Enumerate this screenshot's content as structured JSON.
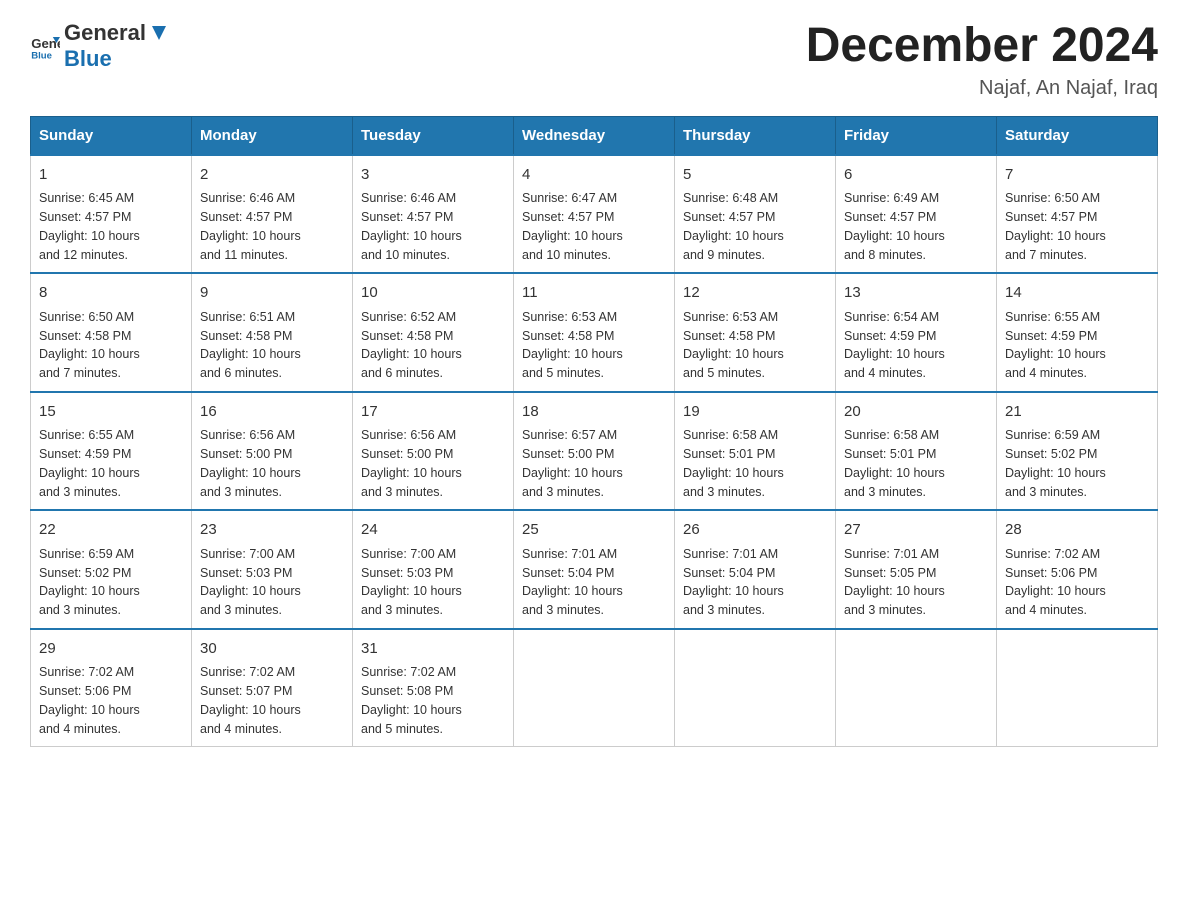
{
  "header": {
    "logo_general": "General",
    "logo_blue": "Blue",
    "month_title": "December 2024",
    "location": "Najaf, An Najaf, Iraq"
  },
  "days_of_week": [
    "Sunday",
    "Monday",
    "Tuesday",
    "Wednesday",
    "Thursday",
    "Friday",
    "Saturday"
  ],
  "weeks": [
    [
      {
        "day": "1",
        "sunrise": "6:45 AM",
        "sunset": "4:57 PM",
        "daylight": "10 hours and 12 minutes."
      },
      {
        "day": "2",
        "sunrise": "6:46 AM",
        "sunset": "4:57 PM",
        "daylight": "10 hours and 11 minutes."
      },
      {
        "day": "3",
        "sunrise": "6:46 AM",
        "sunset": "4:57 PM",
        "daylight": "10 hours and 10 minutes."
      },
      {
        "day": "4",
        "sunrise": "6:47 AM",
        "sunset": "4:57 PM",
        "daylight": "10 hours and 10 minutes."
      },
      {
        "day": "5",
        "sunrise": "6:48 AM",
        "sunset": "4:57 PM",
        "daylight": "10 hours and 9 minutes."
      },
      {
        "day": "6",
        "sunrise": "6:49 AM",
        "sunset": "4:57 PM",
        "daylight": "10 hours and 8 minutes."
      },
      {
        "day": "7",
        "sunrise": "6:50 AM",
        "sunset": "4:57 PM",
        "daylight": "10 hours and 7 minutes."
      }
    ],
    [
      {
        "day": "8",
        "sunrise": "6:50 AM",
        "sunset": "4:58 PM",
        "daylight": "10 hours and 7 minutes."
      },
      {
        "day": "9",
        "sunrise": "6:51 AM",
        "sunset": "4:58 PM",
        "daylight": "10 hours and 6 minutes."
      },
      {
        "day": "10",
        "sunrise": "6:52 AM",
        "sunset": "4:58 PM",
        "daylight": "10 hours and 6 minutes."
      },
      {
        "day": "11",
        "sunrise": "6:53 AM",
        "sunset": "4:58 PM",
        "daylight": "10 hours and 5 minutes."
      },
      {
        "day": "12",
        "sunrise": "6:53 AM",
        "sunset": "4:58 PM",
        "daylight": "10 hours and 5 minutes."
      },
      {
        "day": "13",
        "sunrise": "6:54 AM",
        "sunset": "4:59 PM",
        "daylight": "10 hours and 4 minutes."
      },
      {
        "day": "14",
        "sunrise": "6:55 AM",
        "sunset": "4:59 PM",
        "daylight": "10 hours and 4 minutes."
      }
    ],
    [
      {
        "day": "15",
        "sunrise": "6:55 AM",
        "sunset": "4:59 PM",
        "daylight": "10 hours and 3 minutes."
      },
      {
        "day": "16",
        "sunrise": "6:56 AM",
        "sunset": "5:00 PM",
        "daylight": "10 hours and 3 minutes."
      },
      {
        "day": "17",
        "sunrise": "6:56 AM",
        "sunset": "5:00 PM",
        "daylight": "10 hours and 3 minutes."
      },
      {
        "day": "18",
        "sunrise": "6:57 AM",
        "sunset": "5:00 PM",
        "daylight": "10 hours and 3 minutes."
      },
      {
        "day": "19",
        "sunrise": "6:58 AM",
        "sunset": "5:01 PM",
        "daylight": "10 hours and 3 minutes."
      },
      {
        "day": "20",
        "sunrise": "6:58 AM",
        "sunset": "5:01 PM",
        "daylight": "10 hours and 3 minutes."
      },
      {
        "day": "21",
        "sunrise": "6:59 AM",
        "sunset": "5:02 PM",
        "daylight": "10 hours and 3 minutes."
      }
    ],
    [
      {
        "day": "22",
        "sunrise": "6:59 AM",
        "sunset": "5:02 PM",
        "daylight": "10 hours and 3 minutes."
      },
      {
        "day": "23",
        "sunrise": "7:00 AM",
        "sunset": "5:03 PM",
        "daylight": "10 hours and 3 minutes."
      },
      {
        "day": "24",
        "sunrise": "7:00 AM",
        "sunset": "5:03 PM",
        "daylight": "10 hours and 3 minutes."
      },
      {
        "day": "25",
        "sunrise": "7:01 AM",
        "sunset": "5:04 PM",
        "daylight": "10 hours and 3 minutes."
      },
      {
        "day": "26",
        "sunrise": "7:01 AM",
        "sunset": "5:04 PM",
        "daylight": "10 hours and 3 minutes."
      },
      {
        "day": "27",
        "sunrise": "7:01 AM",
        "sunset": "5:05 PM",
        "daylight": "10 hours and 3 minutes."
      },
      {
        "day": "28",
        "sunrise": "7:02 AM",
        "sunset": "5:06 PM",
        "daylight": "10 hours and 4 minutes."
      }
    ],
    [
      {
        "day": "29",
        "sunrise": "7:02 AM",
        "sunset": "5:06 PM",
        "daylight": "10 hours and 4 minutes."
      },
      {
        "day": "30",
        "sunrise": "7:02 AM",
        "sunset": "5:07 PM",
        "daylight": "10 hours and 4 minutes."
      },
      {
        "day": "31",
        "sunrise": "7:02 AM",
        "sunset": "5:08 PM",
        "daylight": "10 hours and 5 minutes."
      },
      null,
      null,
      null,
      null
    ]
  ],
  "labels": {
    "sunrise": "Sunrise:",
    "sunset": "Sunset:",
    "daylight": "Daylight:"
  }
}
